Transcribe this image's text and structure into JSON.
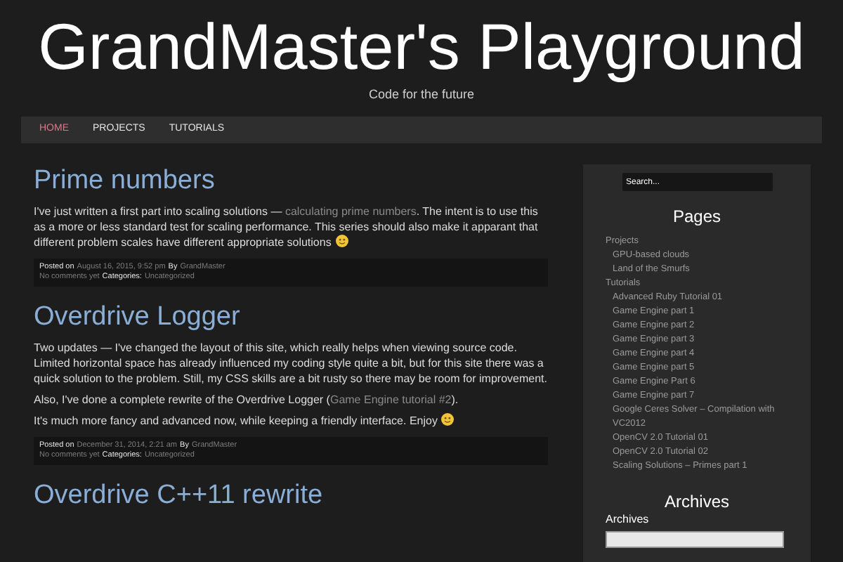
{
  "site": {
    "title": "GrandMaster's Playground",
    "tagline": "Code for the future"
  },
  "nav": [
    {
      "label": "HOME",
      "selected": true
    },
    {
      "label": "PROJECTS",
      "selected": false
    },
    {
      "label": "TUTORIALS",
      "selected": false
    }
  ],
  "posts": [
    {
      "title": "Prime numbers",
      "paragraphs": [
        {
          "segments": [
            {
              "kind": "text",
              "text": "I've just written a first part into scaling solutions — "
            },
            {
              "kind": "link",
              "text": "calculating prime numbers"
            },
            {
              "kind": "text",
              "text": ". The intent is to use this as a more or less standard test for scaling performance. This series should also make it apparant that different problem scales have different appropriate solutions"
            }
          ],
          "smiley": true
        }
      ],
      "meta": {
        "posted_label": "Posted on",
        "date": "August 16, 2015, 9:52 pm",
        "by_label": "By",
        "author": "GrandMaster",
        "comments": "No comments yet",
        "categories_label": "Categories:",
        "category": "Uncategorized"
      }
    },
    {
      "title": "Overdrive Logger",
      "paragraphs": [
        {
          "segments": [
            {
              "kind": "text",
              "text": "Two updates — I've changed the layout of this site, which really helps when viewing source code. Limited horizontal space has already influenced my coding style quite a bit, but for this site there was a quick solution to the problem. Still, my CSS skills are a bit rusty so there may be room for improvement."
            }
          ],
          "smiley": false
        },
        {
          "segments": [
            {
              "kind": "text",
              "text": "Also, I've done a complete rewrite of the Overdrive Logger ("
            },
            {
              "kind": "link",
              "text": "Game Engine tutorial #2"
            },
            {
              "kind": "text",
              "text": ")."
            }
          ],
          "smiley": false
        },
        {
          "segments": [
            {
              "kind": "text",
              "text": "It's much more fancy and advanced now, while keeping a friendly interface. Enjoy"
            }
          ],
          "smiley": true
        }
      ],
      "meta": {
        "posted_label": "Posted on",
        "date": "December 31, 2014, 2:21 am",
        "by_label": "By",
        "author": "GrandMaster",
        "comments": "No comments yet",
        "categories_label": "Categories:",
        "category": "Uncategorized"
      }
    },
    {
      "title": "Overdrive C++11 rewrite"
    }
  ],
  "sidebar": {
    "search": {
      "placeholder": "Search..."
    },
    "pages_heading": "Pages",
    "pages": [
      {
        "label": "Projects",
        "children": [
          {
            "label": "GPU-based clouds"
          },
          {
            "label": "Land of the Smurfs"
          }
        ]
      },
      {
        "label": "Tutorials",
        "children": [
          {
            "label": "Advanced Ruby Tutorial 01"
          },
          {
            "label": "Game Engine part 1"
          },
          {
            "label": "Game Engine part 2"
          },
          {
            "label": "Game Engine part 3"
          },
          {
            "label": "Game Engine part 4"
          },
          {
            "label": "Game Engine part 5"
          },
          {
            "label": "Game Engine Part 6"
          },
          {
            "label": "Game Engine part 7"
          },
          {
            "label": "Google Ceres Solver – Compilation with VC2012"
          },
          {
            "label": "OpenCV 2.0 Tutorial 01"
          },
          {
            "label": "OpenCV 2.0 Tutorial 02"
          },
          {
            "label": "Scaling Solutions – Primes part 1"
          }
        ]
      }
    ],
    "archives_heading": "Archives",
    "archives_label": "Archives"
  }
}
